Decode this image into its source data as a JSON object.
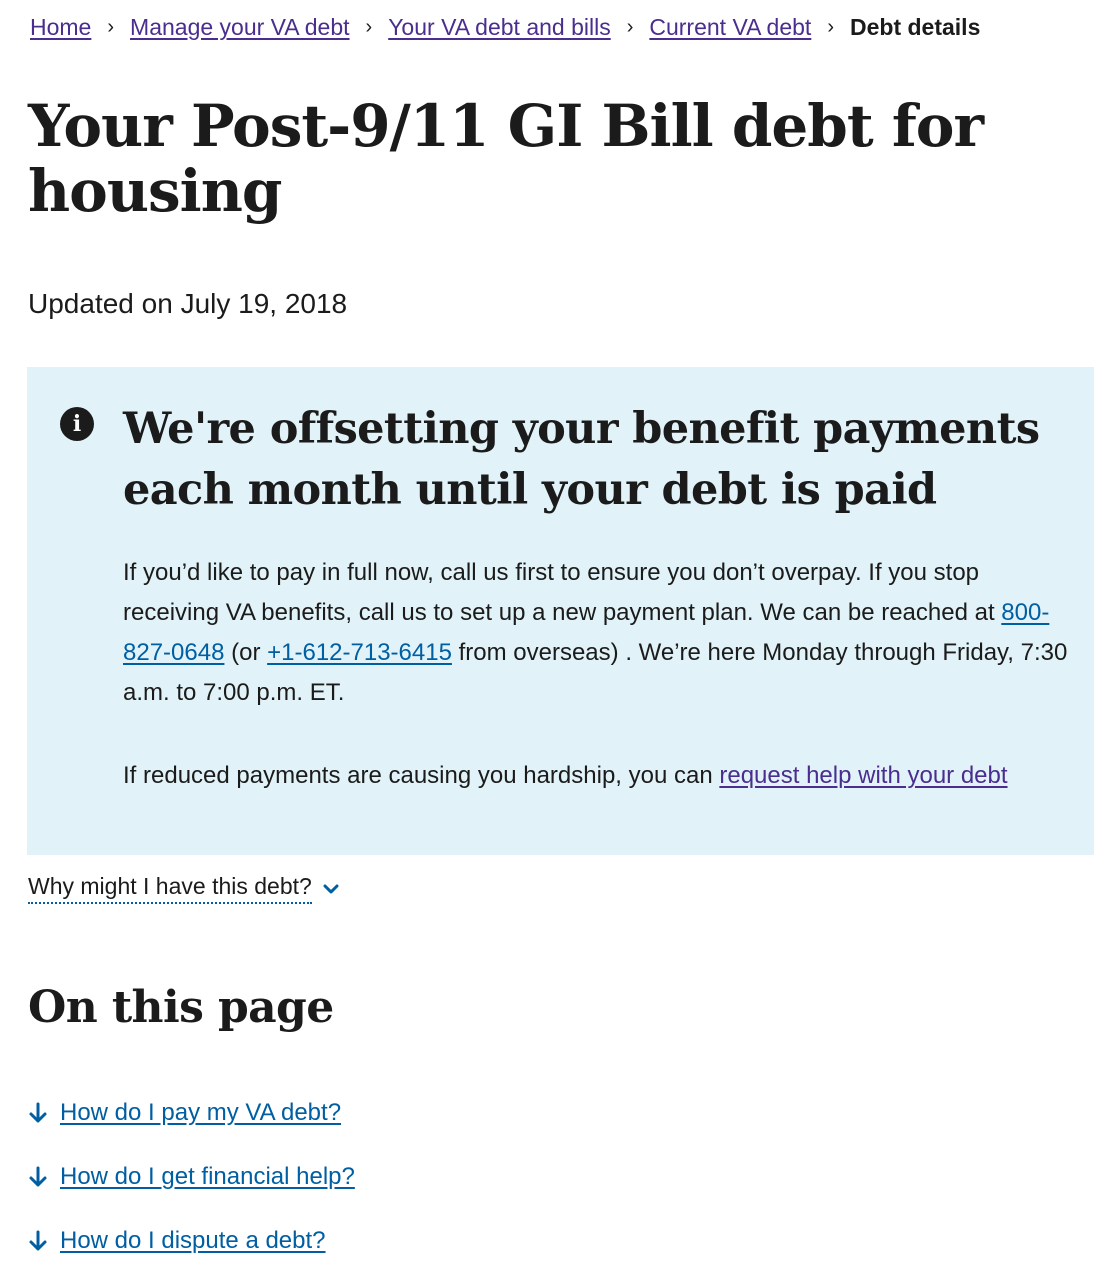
{
  "breadcrumb": {
    "items": [
      "Home",
      "Manage your VA debt",
      "Your VA debt and bills",
      "Current VA debt"
    ],
    "current": "Debt details",
    "separator": "›"
  },
  "page": {
    "title": "Your Post-9/11 GI Bill debt for housing",
    "updated": "Updated on July 19, 2018"
  },
  "alert": {
    "icon": "info-icon",
    "heading": "We're offsetting your benefit payments each month until your debt is paid",
    "body_part1": "If you’d like to pay in full now, call us first to ensure you don’t overpay. If you stop receiving VA benefits, call us to set up a new payment plan. We can be reached at ",
    "phone": "800-827-0648",
    "body_part2": " (or ",
    "overseas_phone": "+1-612-713-6415",
    "body_part3": " from overseas) . We’re here Monday through Friday, 7:30 a.m. to 7:00 p.m. ET.",
    "hardship_text": "If reduced payments are causing you hardship, you can ",
    "hardship_link": "request help with your debt"
  },
  "additional_info": {
    "label": "Why might I have this debt?",
    "icon": "chevron-down-icon"
  },
  "on_this_page": {
    "heading": "On this page",
    "links": [
      "How do I pay my VA debt?",
      "How do I get financial help?",
      "How do I dispute a debt?"
    ]
  },
  "colors": {
    "link": "#005ea2",
    "visited_link": "#4a2d8e",
    "alert_bg": "#e1f3f8",
    "text": "#1b1b1b"
  }
}
